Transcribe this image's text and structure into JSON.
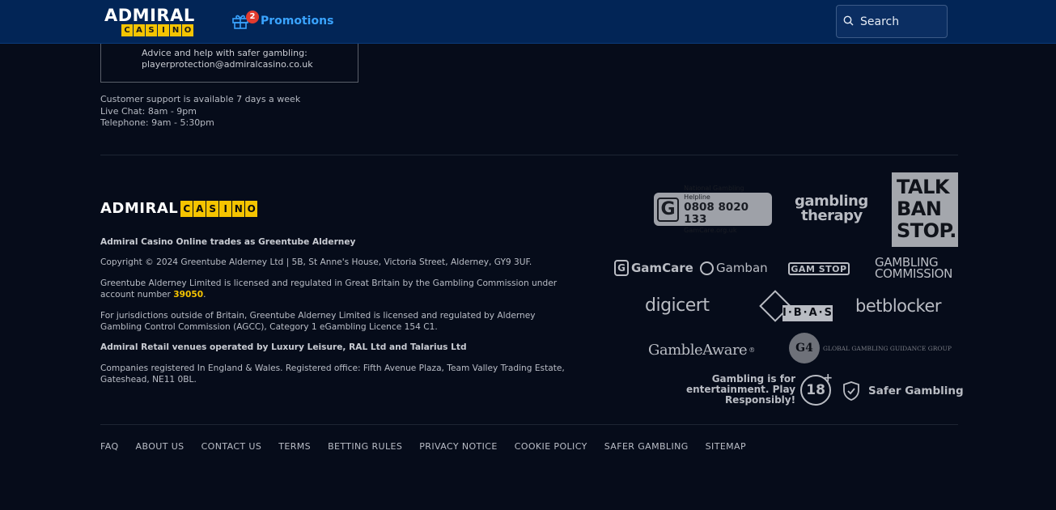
{
  "header": {
    "logo_top": "ADMIRAL",
    "logo_bottom": [
      "C",
      "A",
      "S",
      "I",
      "N",
      "O"
    ],
    "promo_count": "2",
    "promo_label": "Promotions",
    "search_placeholder": "Search"
  },
  "support": {
    "advice_line": "Advice and help with safer gambling:",
    "email": "playerprotection@admiralcasino.co.uk",
    "hours_title": "Customer support is available 7 days a week",
    "live_chat": "Live Chat: 8am - 9pm",
    "telephone": "Telephone: 9am - 5:30pm"
  },
  "brand": {
    "word": "ADMIRAL",
    "boxes": [
      "C",
      "A",
      "S",
      "I",
      "N",
      "O"
    ]
  },
  "legal": {
    "p1": "Admiral Casino Online trades as Greentube Alderney",
    "p2": "Copyright © 2024 Greentube Alderney Ltd | 5B, St Anne's House, Victoria Street, Alderney, GY9 3UF.",
    "p3_text": "Greentube Alderney Limited is licensed and regulated in Great Britain by the Gambling Commission under account number ",
    "p3_link": "39050",
    "p4": "For jurisdictions outside of Britain, Greentube Alderney Limited is licensed and regulated by Alderney Gambling Control Commission (AGCC), Category 1 eGambling Licence 154 C1.",
    "p5": "Admiral Retail venues operated by Luxury Leisure, RAL Ltd and Talarius Ltd",
    "p6": "Companies registered In England & Wales. Registered office: Fifth Avenue Plaza, Team Valley Trading Estate, Gateshead, NE11 0BL."
  },
  "logos": {
    "helpline_small": "National Gambling Helpline",
    "helpline_number": "0808 8020 133",
    "helpline_site": "GamCare.org.uk",
    "gtherapy_1": "gambling",
    "gtherapy_2": "therapy",
    "talkban_1": "TALK",
    "talkban_2": "BAN",
    "talkban_3": "STOP.",
    "gamcare": "GamCare",
    "gamban": "Gamban",
    "gamstop": "GAM STOP",
    "gcomm_1": "GAMBLING",
    "gcomm_2": "COMMISSION",
    "digicert": "digicert",
    "ibas": "I·B·A·S",
    "betblocker": "betblocker",
    "gambleaware": "GambleAware",
    "g4_mark": "G4",
    "g4_text": "GLOBAL GAMBLING GUIDANCE GROUP",
    "play_1": "Gambling is for",
    "play_2": "entertainment. Play",
    "play_3": "Responsibly!",
    "age": "18",
    "safer": "Safer Gambling"
  },
  "footer_links": [
    "FAQ",
    "ABOUT US",
    "CONTACT US",
    "TERMS",
    "BETTING RULES",
    "PRIVACY NOTICE",
    "COOKIE POLICY",
    "SAFER GAMBLING",
    "SITEMAP"
  ],
  "colors": {
    "accent_yellow": "#f5c400",
    "header_blue": "#022556",
    "promo_blue": "#3aa4ff",
    "badge_red": "#e23b2e"
  }
}
